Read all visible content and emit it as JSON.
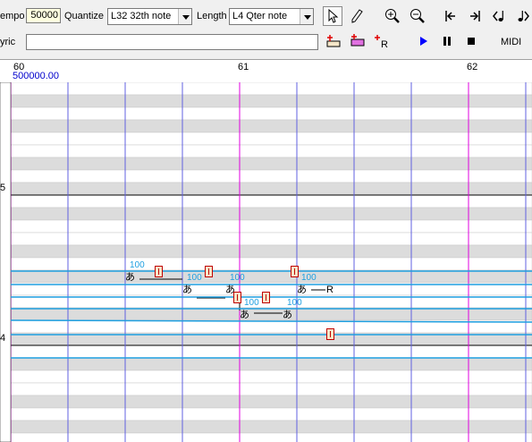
{
  "toolbar": {
    "tempo_label": "empo",
    "tempo_value": "50000",
    "quantize_label": "Quantize",
    "quantize_value": "L32  32th note",
    "length_label": "Length",
    "length_value": "L4   Qter note",
    "lyric_label": "yric",
    "lyric_value": "",
    "midi_label": "MIDI"
  },
  "tools": {
    "pointer_icon": "pointer-icon",
    "pencil_icon": "pencil-icon",
    "zoom_in_icon": "zoom-in-icon",
    "zoom_out_icon": "zoom-out-icon",
    "go_start_icon": "go-to-start-icon",
    "go_end_icon": "go-to-end-icon",
    "play_icon": "play-icon",
    "pause_icon": "pause-icon",
    "stop_icon": "stop-icon"
  },
  "colors": {
    "bar_line": "#e000e0",
    "beat_line": "#6060e0",
    "black_key_row": "#dcdcdc",
    "white_key_row": "#ffffff",
    "note_line": "#1e9fe0",
    "play_blue": "#0000ff"
  },
  "ruler": {
    "measure_start": "60",
    "measure_mid": "61",
    "measure_end": "62",
    "tempo_mark": "500000.00"
  },
  "octaves": {
    "label_5": "5",
    "label_4": "4"
  },
  "notes": [
    {
      "lyric": "あ",
      "velocity": "100"
    },
    {
      "lyric": "あ",
      "velocity": "100"
    },
    {
      "lyric": "あ",
      "velocity": "100"
    },
    {
      "lyric": "あ",
      "velocity": "100"
    },
    {
      "lyric": "あ",
      "velocity": "100"
    },
    {
      "lyric": "あ",
      "velocity": "100"
    },
    {
      "lyric": "R",
      "velocity": "100"
    }
  ]
}
